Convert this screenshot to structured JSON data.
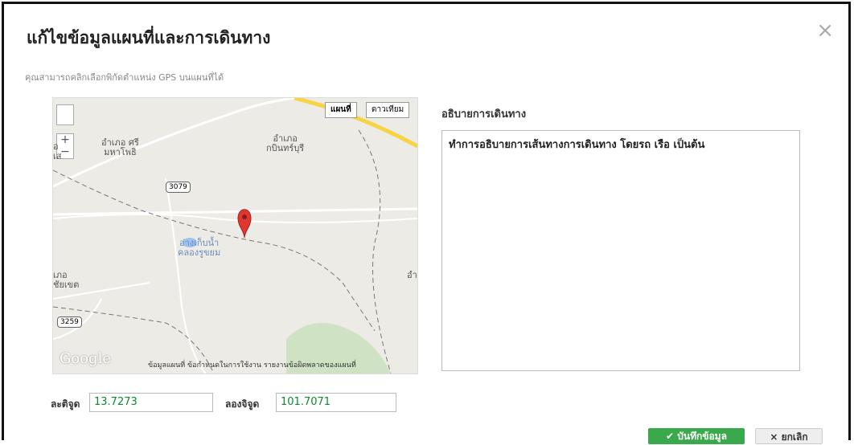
{
  "dialog": {
    "title": "แก้ไขข้อมูลแผนที่และการเดินทาง",
    "close_icon": "close-icon",
    "hint": "คุณสามารถคลิกเลือกพิกัดตำแหน่ง GPS บนแผนที่ได้"
  },
  "map": {
    "type_map": "แผนที่",
    "type_satellite": "ดาวเทียม",
    "zoom_in": "+",
    "zoom_out": "−",
    "labels": {
      "a": "อำเภอ ศรี\nมหาโพธิ",
      "b": "อำเภอ\nกบินทร์บุรี",
      "c": "อ่างเก็บน้ำ\nคลองรูขยม",
      "d": "เภอ\nชัยเขต",
      "e": "อำ",
      "f": "อ\nเส"
    },
    "road_3079": "3079",
    "road_3259": "3259",
    "attribution": "ข้อมูลแผนที่   ข้อกำหนดในการใช้งาน   รายงานข้อผิดพลาดของแผนที่",
    "logo": "Google"
  },
  "description": {
    "label": "อธิบายการเดินทาง",
    "text": "ทำการอธิบายการเส้นทางการเดินทาง  โดยรถ เรือ เป็นต้น"
  },
  "coords": {
    "lat_label": "ละติจูด",
    "lat_value": "13.7273",
    "lng_label": "ลองจิจูด",
    "lng_value": "101.7071"
  },
  "buttons": {
    "save": "✔ บันทึกข้อมูล",
    "cancel": "× ยกเลิก"
  },
  "colors": {
    "accent_green": "#3aa94c",
    "marker_red": "#e0382e",
    "value_green": "#0a8a2a"
  }
}
